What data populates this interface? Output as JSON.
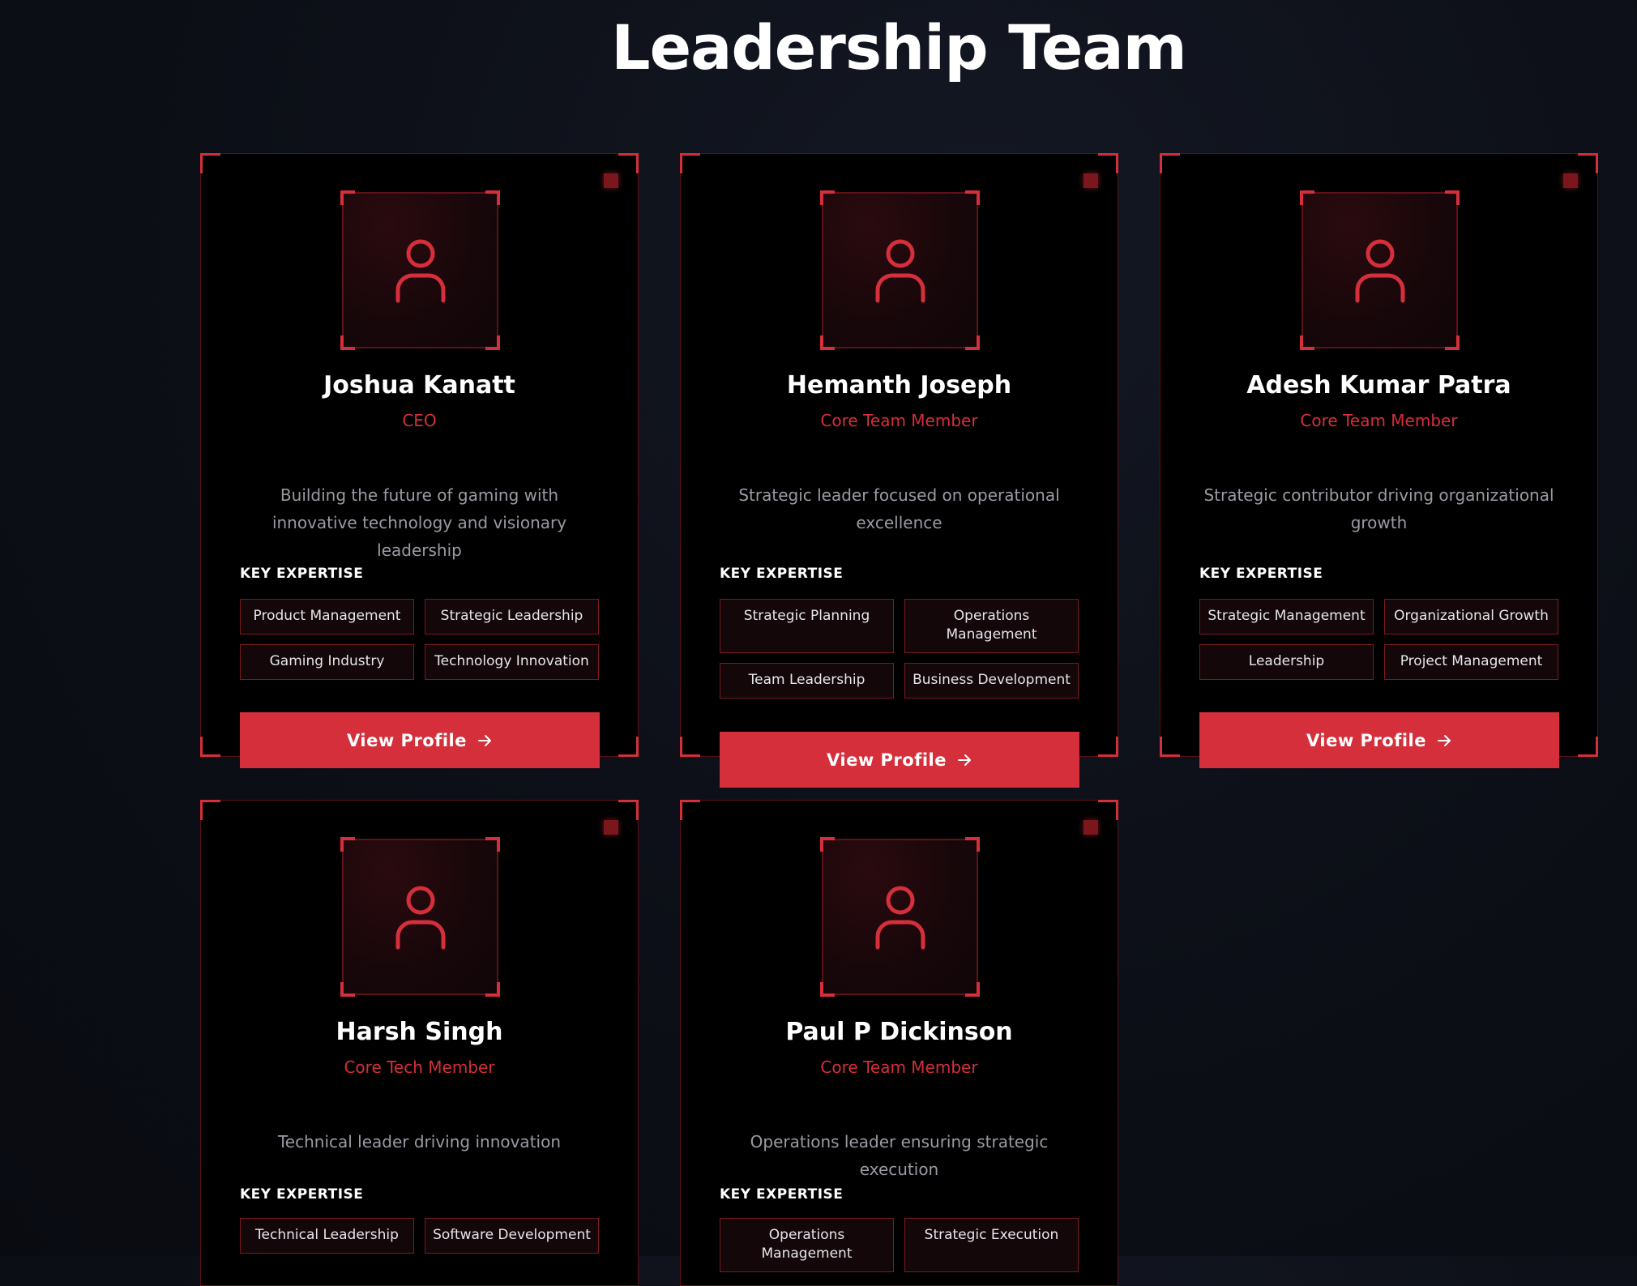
{
  "page": {
    "title": "Leadership Team"
  },
  "labels": {
    "expertise_heading": "KEY EXPERTISE",
    "view_profile": "View Profile"
  },
  "colors": {
    "accent": "#d42f3a",
    "card_background": "#000000",
    "page_background": "#0d1018",
    "description_text": "#9a9aa4"
  },
  "icons": {
    "avatar": "user-icon",
    "button": "arrow-right-icon"
  },
  "members": [
    {
      "name": "Joshua Kanatt",
      "role": "CEO",
      "description": "Building the future of gaming with innovative technology and visionary leadership",
      "expertise": [
        "Product Management",
        "Strategic Leadership",
        "Gaming Industry",
        "Technology Innovation"
      ]
    },
    {
      "name": "Hemanth Joseph",
      "role": "Core Team Member",
      "description": "Strategic leader focused on operational excellence",
      "expertise": [
        "Strategic Planning",
        "Operations Management",
        "Team Leadership",
        "Business Development"
      ]
    },
    {
      "name": "Adesh Kumar Patra",
      "role": "Core Team Member",
      "description": "Strategic contributor driving organizational growth",
      "expertise": [
        "Strategic Management",
        "Organizational Growth",
        "Leadership",
        "Project Management"
      ]
    },
    {
      "name": "Harsh Singh",
      "role": "Core Tech Member",
      "description": "Technical leader driving innovation",
      "expertise": [
        "Technical Leadership",
        "Software Development"
      ]
    },
    {
      "name": "Paul P Dickinson",
      "role": "Core Team Member",
      "description": "Operations leader ensuring strategic execution",
      "expertise": [
        "Operations Management",
        "Strategic Execution"
      ]
    }
  ]
}
